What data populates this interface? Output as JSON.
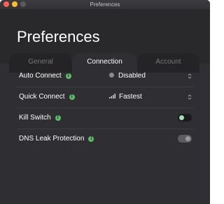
{
  "window": {
    "title": "Preferences",
    "traffic_colors": {
      "close": "#fe5f57",
      "minimize": "#febc2e",
      "zoom": "#5a5a5e"
    }
  },
  "header": {
    "title": "Preferences"
  },
  "tabs": [
    {
      "label": "General",
      "selected": false
    },
    {
      "label": "Connection",
      "selected": true
    },
    {
      "label": "Account",
      "selected": false
    }
  ],
  "settings": {
    "auto_connect": {
      "label": "Auto Connect",
      "value": "Disabled",
      "info_icon": "info-icon",
      "status_icon": "gray-dot-icon"
    },
    "quick_connect": {
      "label": "Quick Connect",
      "value": "Fastest",
      "info_icon": "info-icon",
      "status_icon": "signal-bars-icon"
    },
    "kill_switch": {
      "label": "Kill Switch",
      "info_icon": "info-icon",
      "toggle_on": false
    },
    "dns_leak_protection": {
      "label": "DNS Leak Protection",
      "info_icon": "info-icon",
      "toggle_on": true,
      "toggle_disabled": true
    }
  },
  "colors": {
    "background": "#2f2f33",
    "header_background": "#29292c",
    "accent_green": "#5dbb63",
    "toggle_knob_green": "#9fe0b0"
  }
}
